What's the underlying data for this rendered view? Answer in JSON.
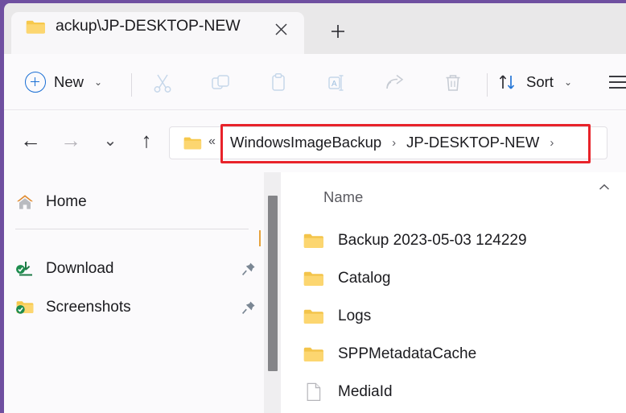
{
  "window": {
    "border_color": "#6f4fa0",
    "titlebar_bg": "#e9e8e9"
  },
  "tab": {
    "icon": "folder-icon",
    "title": "ackup\\JP-DESKTOP-NEW",
    "close_label": "✕",
    "new_tab_label": "+"
  },
  "toolbar": {
    "new_label": "New",
    "new_chevron": "⌄",
    "sort_label": "Sort",
    "sort_chevron": "⌄",
    "items": [
      {
        "name": "cut-icon",
        "enabled": false
      },
      {
        "name": "copy-icon",
        "enabled": false
      },
      {
        "name": "paste-icon",
        "enabled": false
      },
      {
        "name": "rename-icon",
        "enabled": false
      },
      {
        "name": "share-icon",
        "enabled": false
      },
      {
        "name": "delete-icon",
        "enabled": false
      }
    ],
    "menu_icon": "hamburger-menu-icon"
  },
  "navigation": {
    "back": "←",
    "forward": "→",
    "recent": "⌄",
    "up": "↑"
  },
  "address": {
    "folder_icon": "folder-icon",
    "overflow": "«",
    "highlight_color": "#e8232a",
    "crumbs": [
      {
        "label": "WindowsImageBackup"
      },
      {
        "label": "JP-DESKTOP-NEW"
      }
    ],
    "separator": "›",
    "trailing_separator": "›"
  },
  "sidebar": {
    "items": [
      {
        "label": "Home",
        "icon": "home-icon",
        "pinned": false
      },
      {
        "label": "Download",
        "icon": "download-sync-icon",
        "pinned": true
      },
      {
        "label": "Screenshots",
        "icon": "folder-sync-icon",
        "pinned": true
      }
    ]
  },
  "filelist": {
    "column_header": "Name",
    "sort_indicator": "chevron-up-icon",
    "rows": [
      {
        "name": "Backup 2023-05-03 124229",
        "type": "folder"
      },
      {
        "name": "Catalog",
        "type": "folder"
      },
      {
        "name": "Logs",
        "type": "folder"
      },
      {
        "name": "SPPMetadataCache",
        "type": "folder"
      },
      {
        "name": "MediaId",
        "type": "file"
      }
    ]
  }
}
